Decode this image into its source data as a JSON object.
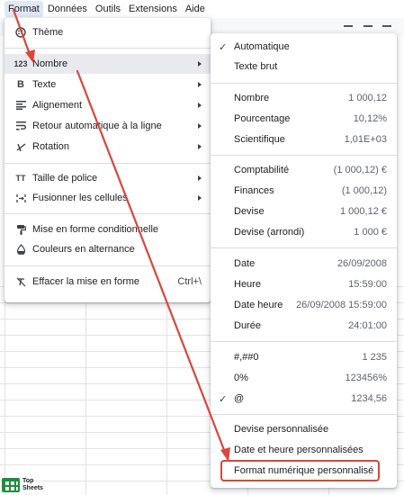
{
  "menubar": {
    "items": [
      {
        "label": "Format",
        "active": true
      },
      {
        "label": "Données"
      },
      {
        "label": "Outils"
      },
      {
        "label": "Extensions"
      },
      {
        "label": "Aide"
      }
    ]
  },
  "format_menu": {
    "items": [
      {
        "icon": "palette-icon",
        "label": "Thème"
      },
      {
        "icon": "number-format-icon",
        "label": "Nombre",
        "icon_text": "123",
        "submenu": true,
        "highlighted": true
      },
      {
        "icon": "bold-icon",
        "label": "Texte",
        "icon_text": "B",
        "submenu": true
      },
      {
        "icon": "align-left-icon",
        "label": "Alignement",
        "submenu": true
      },
      {
        "icon": "text-wrap-icon",
        "label": "Retour automatique à la ligne",
        "submenu": true
      },
      {
        "icon": "text-rotation-icon",
        "label": "Rotation",
        "submenu": true
      },
      {
        "icon": "font-size-icon",
        "label": "Taille de police",
        "icon_text": "TT",
        "submenu": true
      },
      {
        "icon": "merge-cells-icon",
        "label": "Fusionner les cellules",
        "submenu": true
      },
      {
        "icon": "paint-roller-icon",
        "label": "Mise en forme conditionnelle"
      },
      {
        "icon": "alternating-colors-icon",
        "label": "Couleurs en alternance"
      },
      {
        "icon": "clear-format-icon",
        "label": "Effacer la mise en forme",
        "shortcut": "Ctrl+\\"
      }
    ]
  },
  "number_submenu": {
    "items": [
      {
        "label": "Automatique",
        "checked": true,
        "value": ""
      },
      {
        "label": "Texte brut",
        "value": ""
      },
      {
        "label": "Nombre",
        "value": "1 000,12"
      },
      {
        "label": "Pourcentage",
        "value": "10,12%"
      },
      {
        "label": "Scientifique",
        "value": "1,01E+03"
      },
      {
        "label": "Comptabilité",
        "value": "(1 000,12) €"
      },
      {
        "label": "Finances",
        "value": "(1 000,12)"
      },
      {
        "label": "Devise",
        "value": "1 000,12 €"
      },
      {
        "label": "Devise (arrondi)",
        "value": "1 000 €"
      },
      {
        "label": "Date",
        "value": "26/09/2008"
      },
      {
        "label": "Heure",
        "value": "15:59:00"
      },
      {
        "label": "Date heure",
        "value": "26/09/2008 15:59:00"
      },
      {
        "label": "Durée",
        "value": "24:01:00"
      },
      {
        "label": "#,##0",
        "value": "1 235"
      },
      {
        "label": "0%",
        "value": "123456%"
      },
      {
        "label": "@",
        "checked": true,
        "value": "1234,56"
      },
      {
        "label": "Devise personnalisée",
        "value": ""
      },
      {
        "label": "Date et heure personnalisées",
        "value": ""
      },
      {
        "label": "Format numérique personnalisé",
        "value": "",
        "boxed": true
      }
    ]
  },
  "brand": {
    "line1": "Top",
    "line2": "Sheets"
  },
  "colors": {
    "annotation": "#d9463b",
    "highlight": "#e8eaed",
    "menu_active": "#e1e7f5",
    "logo": "#1e8e3e"
  }
}
